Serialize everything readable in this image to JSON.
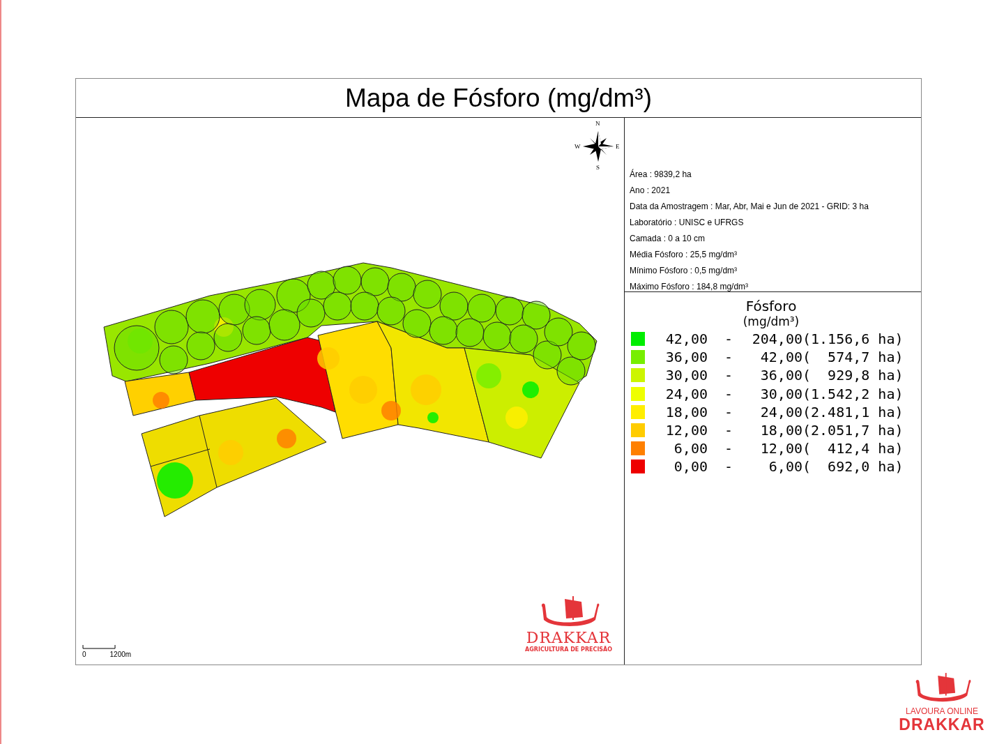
{
  "title": "Mapa de Fósforo (mg/dm³)",
  "compass": {
    "north": "N",
    "west": "W",
    "east": "E",
    "south": "S"
  },
  "scale_bar": {
    "start": "0",
    "end": "1200m"
  },
  "map_logo": {
    "name": "DRAKKAR",
    "tagline": "AGRICULTURA DE PRECISÃO"
  },
  "info": [
    "Área : 9839,2 ha",
    "Ano : 2021",
    "Data da Amostragem : Mar, Abr, Mai e Jun de 2021  -  GRID: 3 ha",
    "Laboratório : UNISC e UFRGS",
    "Camada : 0 a 10 cm",
    "Média Fósforo : 25,5 mg/dm³",
    "Mínimo Fósforo : 0,5 mg/dm³",
    "Máximo Fósforo : 184,8 mg/dm³"
  ],
  "legend": {
    "title": "Fósforo",
    "unit": "(mg/dm³)",
    "classes": [
      {
        "color": "#00ee00",
        "from": "42,00",
        "dash": "-",
        "to": "204,00",
        "area": "(1.156,6 ha)"
      },
      {
        "color": "#77ee00",
        "from": "36,00",
        "dash": "-",
        "to": "42,00",
        "area": "(  574,7 ha)"
      },
      {
        "color": "#ccf500",
        "from": "30,00",
        "dash": "-",
        "to": "36,00",
        "area": "(  929,8 ha)"
      },
      {
        "color": "#eeff00",
        "from": "24,00",
        "dash": "-",
        "to": "30,00",
        "area": "(1.542,2 ha)"
      },
      {
        "color": "#ffee00",
        "from": "18,00",
        "dash": "-",
        "to": "24,00",
        "area": "(2.481,1 ha)"
      },
      {
        "color": "#ffcc00",
        "from": "12,00",
        "dash": "-",
        "to": "18,00",
        "area": "(2.051,7 ha)"
      },
      {
        "color": "#ff8000",
        "from": "6,00",
        "dash": "-",
        "to": "12,00",
        "area": "(  412,4 ha)"
      },
      {
        "color": "#ee0000",
        "from": "0,00",
        "dash": "-",
        "to": "6,00",
        "area": "(  692,0 ha)"
      }
    ]
  },
  "page_logo": {
    "line_1": "LAVOURA ONLINE",
    "line_2": "DRAKKAR"
  }
}
